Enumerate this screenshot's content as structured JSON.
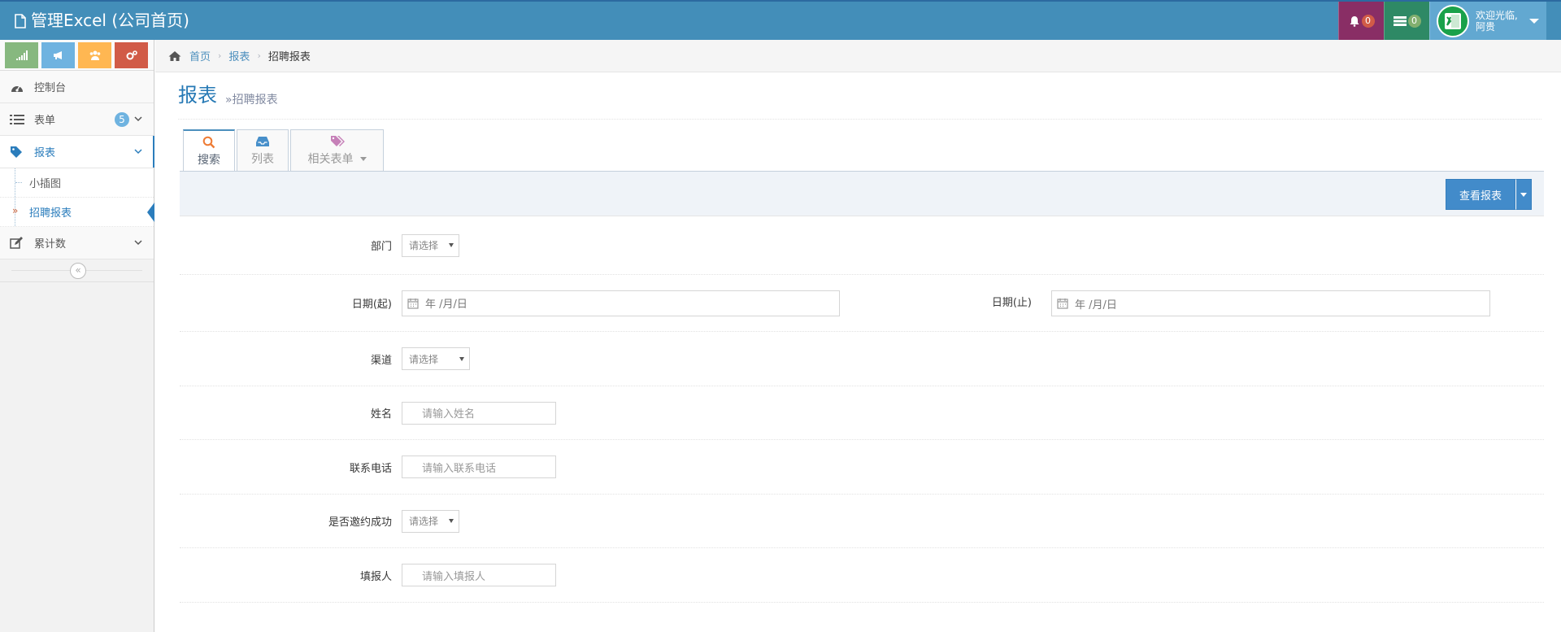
{
  "app": {
    "title": "管理Excel (公司首页)"
  },
  "navbar": {
    "notifications": {
      "count": "0",
      "icon": "bell-icon"
    },
    "tasks": {
      "count": "0",
      "icon": "tasks-icon"
    },
    "user": {
      "welcome": "欢迎光临,",
      "name": "阿贵"
    }
  },
  "sidebar": {
    "shortcuts": [
      {
        "icon": "signal-icon",
        "color": "#87b87f"
      },
      {
        "icon": "bullhorn-icon",
        "color": "#6fb3e0"
      },
      {
        "icon": "users-icon",
        "color": "#ffb752"
      },
      {
        "icon": "cogs-icon",
        "color": "#d15b47"
      }
    ],
    "items": [
      {
        "label": "控制台",
        "icon": "dashboard-icon"
      },
      {
        "label": "表单",
        "icon": "list-icon",
        "badge": "5"
      },
      {
        "label": "报表",
        "icon": "tag-icon",
        "active": true,
        "children": [
          {
            "label": "小插图"
          },
          {
            "label": "招聘报表",
            "active": true
          }
        ]
      },
      {
        "label": "累计数",
        "icon": "edit-icon"
      }
    ]
  },
  "breadcrumb": {
    "home": "首页",
    "section": "报表",
    "current": "招聘报表"
  },
  "page": {
    "title": "报表",
    "subtitle": "»招聘报表"
  },
  "tabs": [
    {
      "label": "搜索",
      "icon": "search-icon",
      "active": true
    },
    {
      "label": "列表",
      "icon": "inbox-icon"
    },
    {
      "label": "相关表单",
      "icon": "tags-icon"
    }
  ],
  "actions": {
    "view_report": "查看报表"
  },
  "form": {
    "department": {
      "label": "部门",
      "value": "请选择"
    },
    "date_start": {
      "label": "日期(起)",
      "value": "年 /月/日"
    },
    "date_end": {
      "label": "日期(止)",
      "value": "年 /月/日"
    },
    "channel": {
      "label": "渠道",
      "value": "请选择"
    },
    "name": {
      "label": "姓名",
      "placeholder": "请输入姓名"
    },
    "phone": {
      "label": "联系电话",
      "placeholder": "请输入联系电话"
    },
    "invited": {
      "label": "是否邀约成功",
      "value": "请选择"
    },
    "reporter": {
      "label": "填报人",
      "placeholder": "请输入填报人"
    }
  },
  "colors": {
    "navbar": "#438eb9",
    "accent": "#2b7dbc",
    "button": "#428bca"
  }
}
